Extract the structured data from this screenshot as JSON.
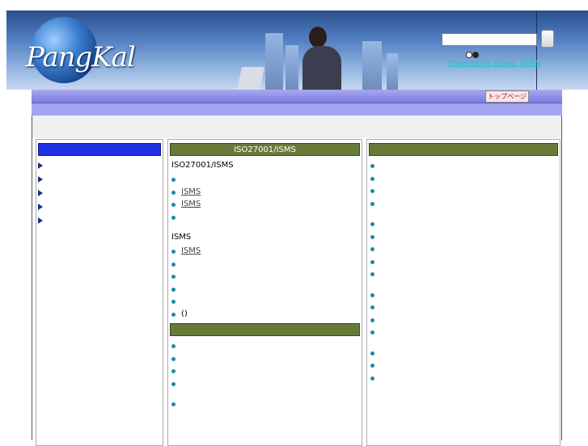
{
  "top_glyph": "",
  "header": {
    "logo": "PangKal",
    "search_radio_text": "",
    "yahoo_text": "Powered by Yahoo! JAPAN"
  },
  "nav": {
    "tab_label": "トップページ",
    "ribbon_text": ""
  },
  "page_title": "",
  "left_menu": {
    "heading": "",
    "items": [
      "",
      "",
      "",
      "",
      ""
    ]
  },
  "middle": {
    "box1": {
      "heading": "ISO27001/ISMS ",
      "section1_title": "ISO27001/ISMS",
      "section1_items": [
        "",
        "ISMS",
        "ISMS",
        ""
      ],
      "section2_title": "ISMS",
      "section2_items": [
        "ISMS",
        "",
        "",
        "",
        "",
        "()"
      ]
    },
    "box2": {
      "heading": "",
      "section1_title": "",
      "section1_items": [
        "",
        "",
        "",
        ""
      ],
      "section2_title": "",
      "section2_items": [
        ""
      ]
    }
  },
  "right": {
    "heading": "",
    "groups": [
      {
        "title": "",
        "items": [
          "",
          "",
          "",
          ""
        ]
      },
      {
        "title": "",
        "items": [
          "",
          "",
          "",
          "",
          ""
        ]
      },
      {
        "title": "",
        "items": [
          "",
          "",
          "",
          ""
        ]
      },
      {
        "title": "",
        "items": [
          "",
          "",
          ""
        ]
      }
    ]
  }
}
